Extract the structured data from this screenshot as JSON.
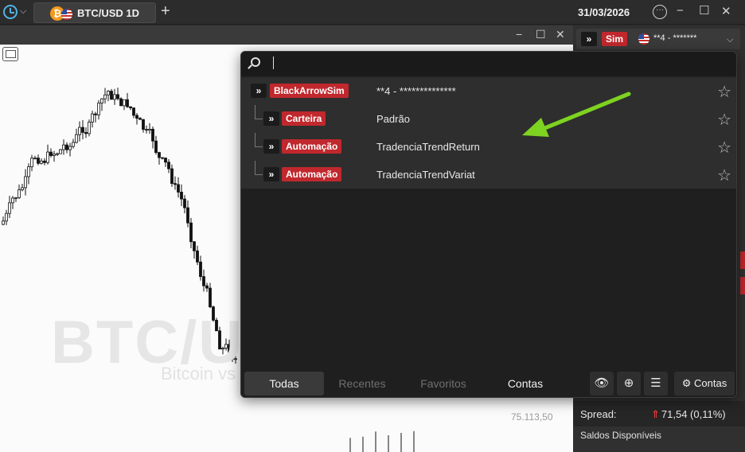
{
  "topbar": {
    "tab_label": "BTC/USD 1D",
    "coin_glyph": "₿",
    "new_tab": "+",
    "date": "31/03/2026"
  },
  "chart": {
    "watermark_symbol": "BTC/U",
    "watermark_name": "Bitcoin vs",
    "price_label": "75.113,50"
  },
  "right_panel": {
    "sim_badge": "Sim",
    "account_mini": "**4 - *******",
    "spread_label": "Spread:",
    "spread_value": "71,54 (0,11%)",
    "saldos_label": "Saldos Disponíveis"
  },
  "popup": {
    "search": {
      "value": "",
      "placeholder": ""
    },
    "rows": [
      {
        "badge": "BlackArrowSim",
        "name": "**4 - **************",
        "level": 0
      },
      {
        "badge": "Carteira",
        "name": "Padrão",
        "level": 1
      },
      {
        "badge": "Automação",
        "name": "TradenciaTrendReturn",
        "level": 1
      },
      {
        "badge": "Automação",
        "name": "TradenciaTrendVariat",
        "level": 1
      }
    ],
    "tabs": {
      "todas": "Todas",
      "recentes": "Recentes",
      "favoritos": "Favoritos",
      "contas": "Contas"
    },
    "contas_button": "Contas"
  },
  "colors": {
    "badge_red": "#c0282d",
    "accent_blue": "#4fb4e6",
    "annotation_green": "#7ed321"
  }
}
